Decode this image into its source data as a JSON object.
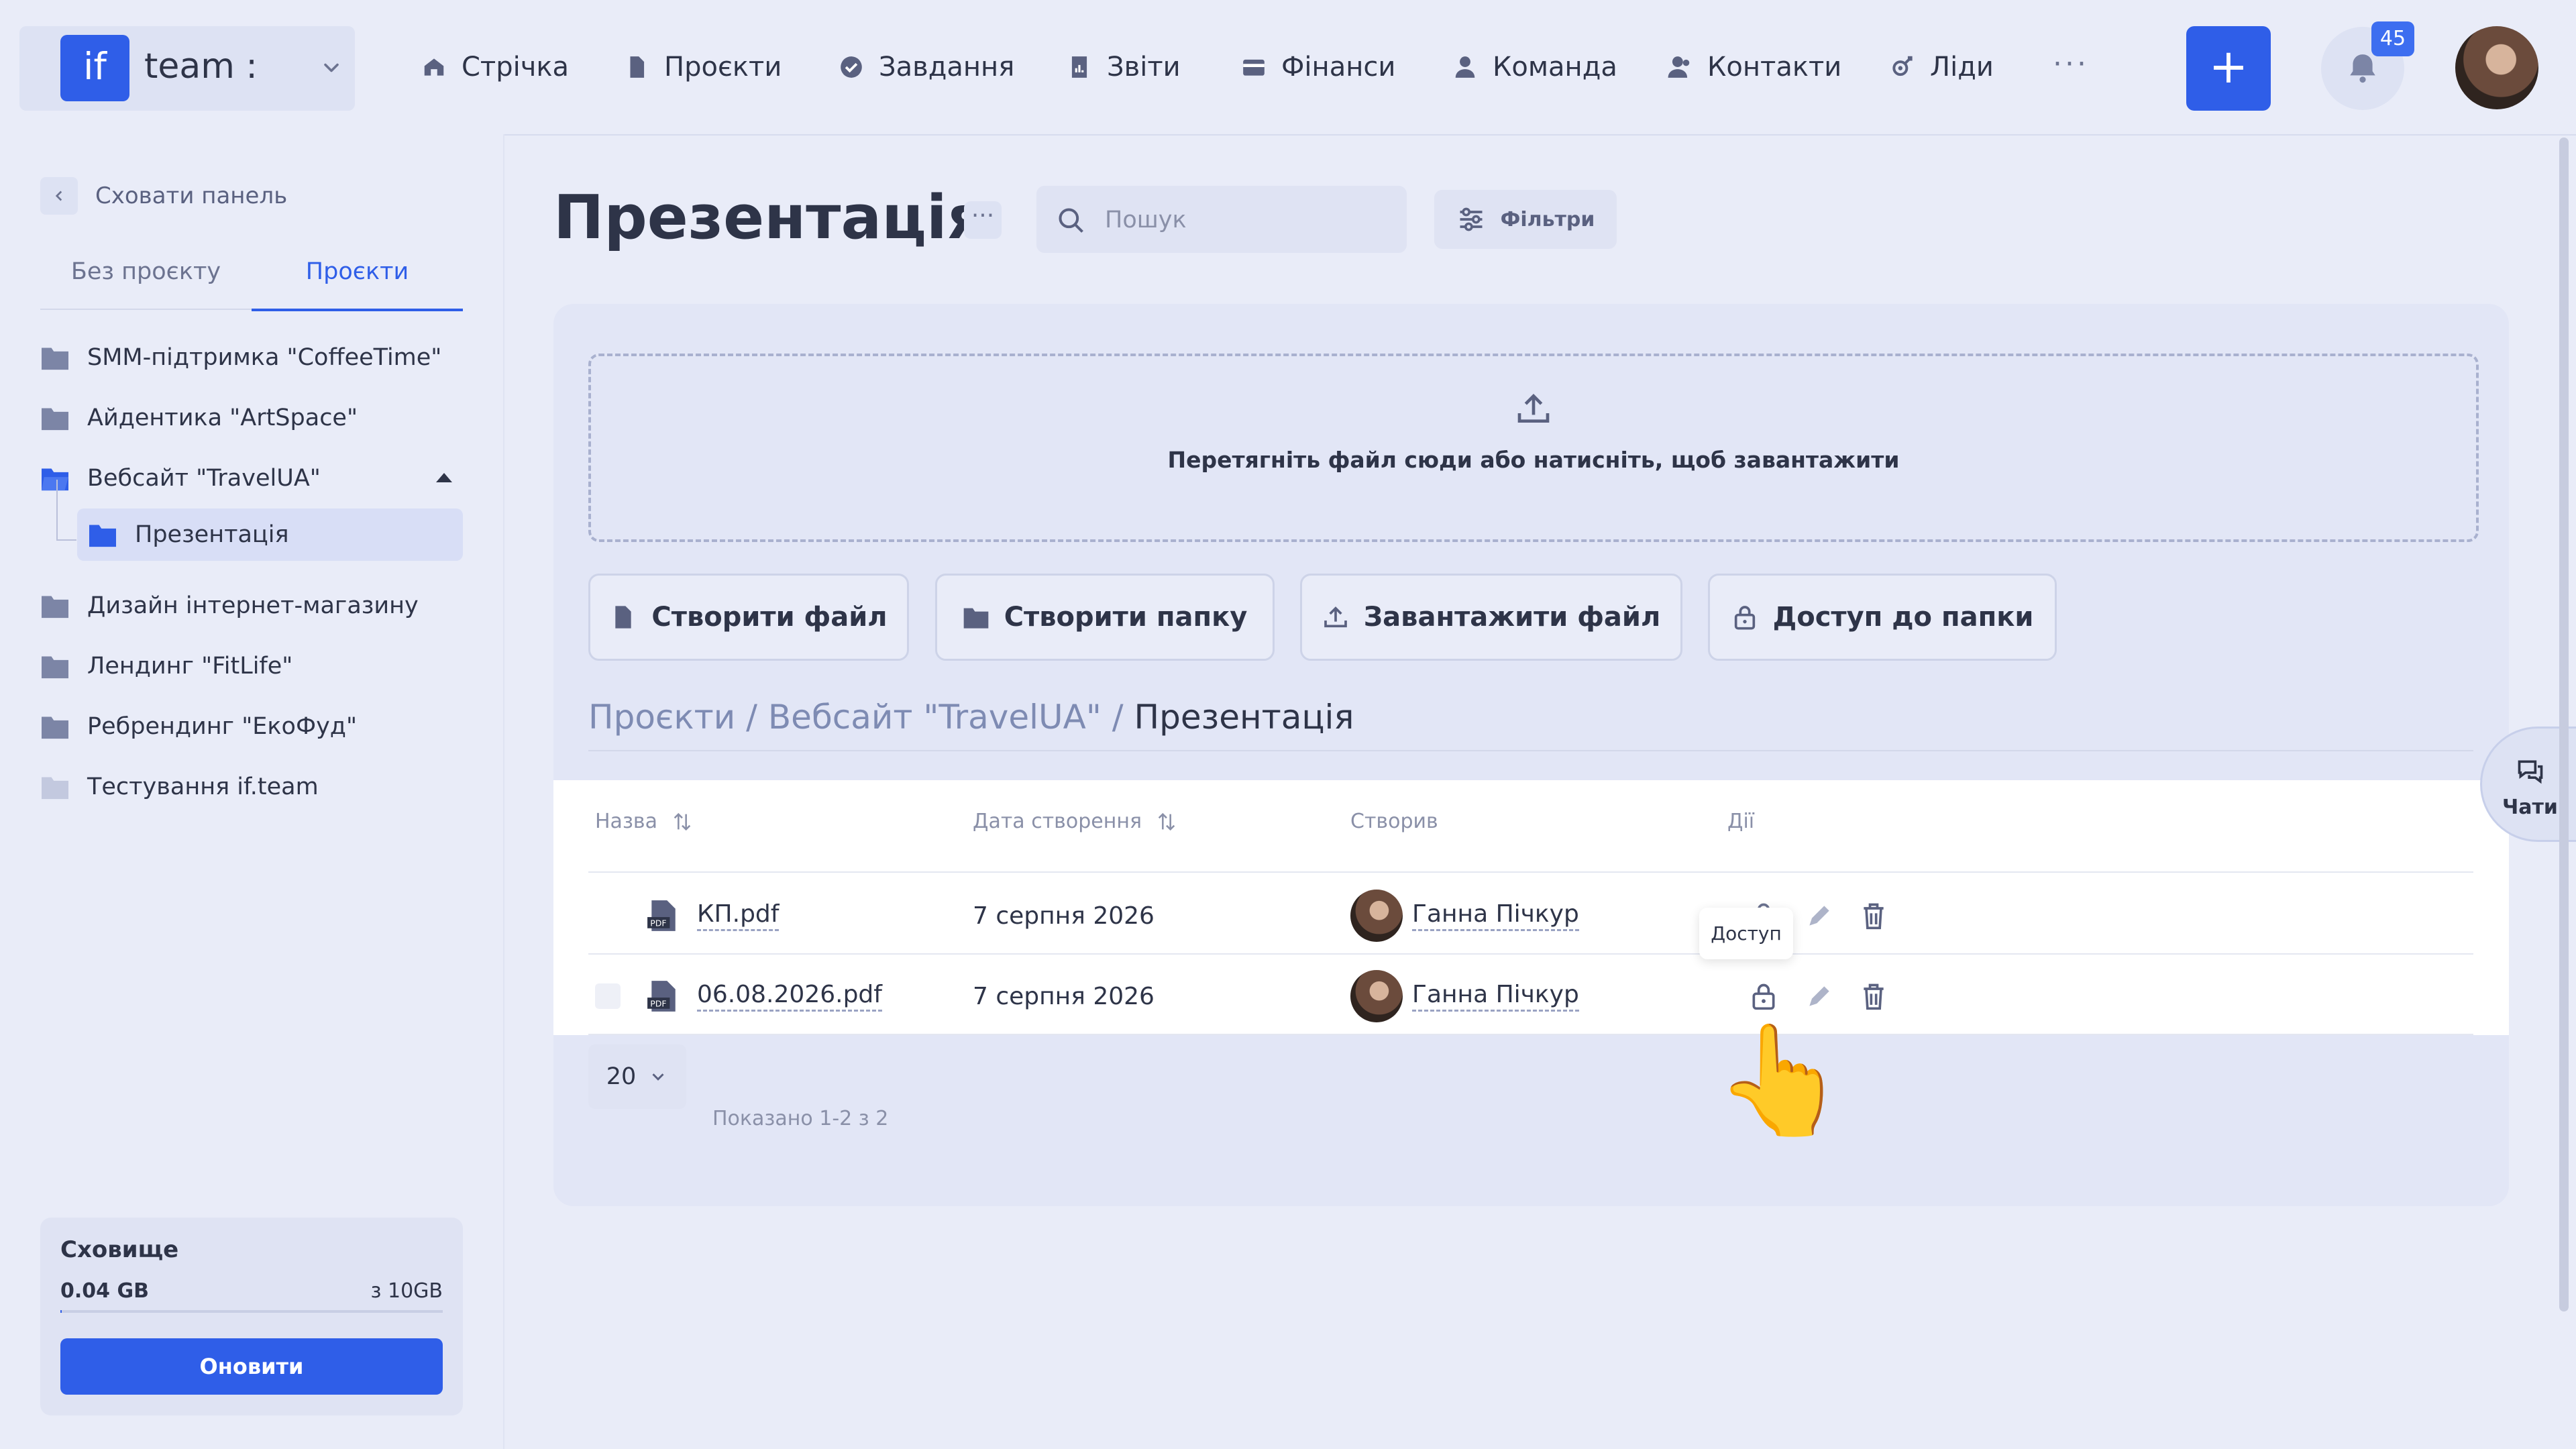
{
  "header": {
    "logo_text": "if",
    "team_name": "team :",
    "nav": [
      {
        "label": "Стрічка",
        "icon": "home-icon"
      },
      {
        "label": "Проєкти",
        "icon": "document-icon"
      },
      {
        "label": "Завдання",
        "icon": "check-circle-icon"
      },
      {
        "label": "Звіти",
        "icon": "report-icon"
      },
      {
        "label": "Фінанси",
        "icon": "wallet-icon"
      },
      {
        "label": "Команда",
        "icon": "user-icon"
      },
      {
        "label": "Контакти",
        "icon": "contacts-icon"
      },
      {
        "label": "Ліди",
        "icon": "leads-icon"
      }
    ],
    "more": "···",
    "add": "+",
    "notifications_count": "45"
  },
  "sidebar": {
    "hide_panel": "Сховати панель",
    "tabs": [
      "Без проєкту",
      "Проєкти"
    ],
    "active_tab": "Проєкти",
    "folders": [
      "SMM-підтримка \"CoffeeTime\"",
      "Айдентика \"ArtSpace\"",
      "Вебсайт \"TravelUA\"",
      "Дизайн інтернет-магазину",
      "Лендинг \"FitLife\"",
      "Ребрендинг \"ЕкоФуд\"",
      "Тестування if.team"
    ],
    "subfolder": "Презентація",
    "storage": {
      "title": "Сховище",
      "used": "0.04 GB",
      "total": "з 10GB",
      "used_fraction": 0.004,
      "upgrade": "Оновити"
    }
  },
  "main": {
    "title": "Презентація",
    "title_menu": "···",
    "search_placeholder": "Пошук",
    "filters": "Фільтри",
    "dropzone": "Перетягніть файл сюди або натисніть, щоб завантажити",
    "actions": {
      "create_file": "Створити файл",
      "create_folder": "Створити папку",
      "upload_file": "Завантажити файл",
      "folder_access": "Доступ до папки"
    },
    "breadcrumb": {
      "root": "Проєкти",
      "sep1": "/",
      "mid": "Вебсайт \"TravelUA\"",
      "sep2": "/",
      "current": "Презентація"
    },
    "table": {
      "headers": {
        "name": "Назва",
        "created": "Дата створення",
        "author": "Створив",
        "actions": "Дії"
      },
      "rows": [
        {
          "name": "КП.pdf",
          "date": "7 серпня 2026",
          "author": "Ганна Пічкур"
        },
        {
          "name": "06.08.2026.pdf",
          "date": "7 серпня 2026",
          "author": "Ганна Пічкур"
        }
      ],
      "tooltip": "Доступ"
    },
    "pagination": {
      "per_page": "20",
      "shown": "Показано 1-2 з 2"
    }
  },
  "chats": "Чати",
  "colors": {
    "accent": "#2f5ee8",
    "background": "#e9ecf8"
  }
}
